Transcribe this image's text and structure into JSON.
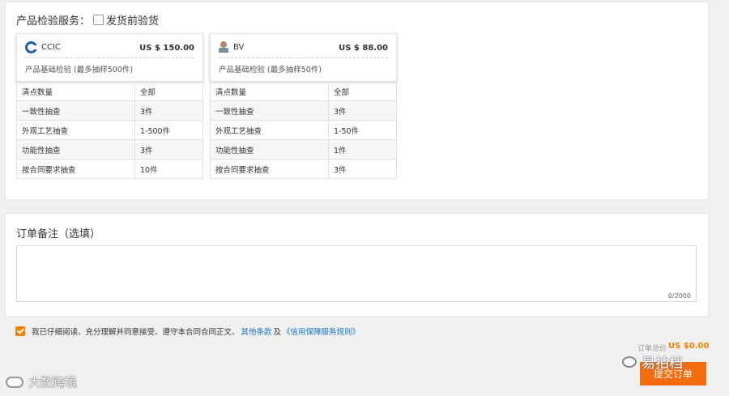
{
  "inspection": {
    "label": "产品检验服务：",
    "checkbox_label": "发货前验货",
    "checked": false
  },
  "providers": [
    {
      "name": "CCIC",
      "price": "US $ 150.00",
      "description": "产品基础检验 (最多抽样500件)",
      "rows": [
        {
          "item": "清点数量",
          "value": "全部"
        },
        {
          "item": "一致性抽查",
          "value": "3件"
        },
        {
          "item": "外观工艺抽查",
          "value": "1-500件"
        },
        {
          "item": "功能性抽查",
          "value": "3件"
        },
        {
          "item": "按合同要求抽查",
          "value": "10件"
        }
      ]
    },
    {
      "name": "BV",
      "price": "US $ 88.00",
      "description": "产品基础检验 (最多抽样50件)",
      "rows": [
        {
          "item": "清点数量",
          "value": "全部"
        },
        {
          "item": "一致性抽查",
          "value": "3件"
        },
        {
          "item": "外观工艺抽查",
          "value": "1-50件"
        },
        {
          "item": "功能性抽查",
          "value": "1件"
        },
        {
          "item": "按合同要求抽查",
          "value": "3件"
        }
      ]
    }
  ],
  "remarks": {
    "title": "订单备注（选填）",
    "value": "",
    "counter": "0/2000"
  },
  "agreement": {
    "checked": true,
    "text": "我已仔细阅读、充分理解并同意接受、遵守本合同合同正文、",
    "link1": "其他条款",
    "and": "及",
    "link2": "《信用保障服务规则》"
  },
  "summary": {
    "total_label": "订单总价",
    "total_value": "US $0.00"
  },
  "submit_label": "提交订单",
  "watermarks": {
    "right": "易拍档",
    "left": "大数跨境"
  },
  "colors": {
    "accent": "#f36c0e",
    "price": "#f08200",
    "link": "#1a73c8"
  }
}
